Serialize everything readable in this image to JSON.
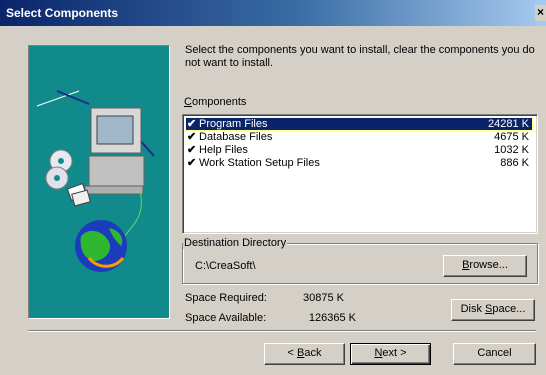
{
  "window": {
    "title": "Select Components",
    "close_glyph": "×"
  },
  "intro": "Select the components you want to install, clear the components you do not want to install.",
  "components": {
    "label": "Components",
    "items": [
      {
        "name": "Program Files",
        "size": "24281 K",
        "checked": true,
        "selected": true
      },
      {
        "name": "Database Files",
        "size": "4675 K",
        "checked": true,
        "selected": false
      },
      {
        "name": "Help Files",
        "size": "1032 K",
        "checked": true,
        "selected": false
      },
      {
        "name": "Work Station Setup Files",
        "size": "886 K",
        "checked": true,
        "selected": false
      }
    ],
    "check_glyph": "✔"
  },
  "destination": {
    "label": "Destination Directory",
    "path": "C:\\CreaSoft\\",
    "browse_label": "Browse..."
  },
  "space": {
    "required_label": "Space Required:",
    "required_value": "30875 K",
    "available_label": "Space Available:",
    "available_value": "126365 K",
    "disk_space_label": "Disk Space..."
  },
  "buttons": {
    "back": "< Back",
    "next": "Next >",
    "cancel": "Cancel"
  },
  "colors": {
    "teal": "#108a8a",
    "selection": "#0a246a",
    "title_start": "#0a246a"
  },
  "icons": [
    "computer-icon",
    "cd-icon",
    "globe-icon",
    "floppy-icon",
    "check-icon",
    "close-icon"
  ]
}
